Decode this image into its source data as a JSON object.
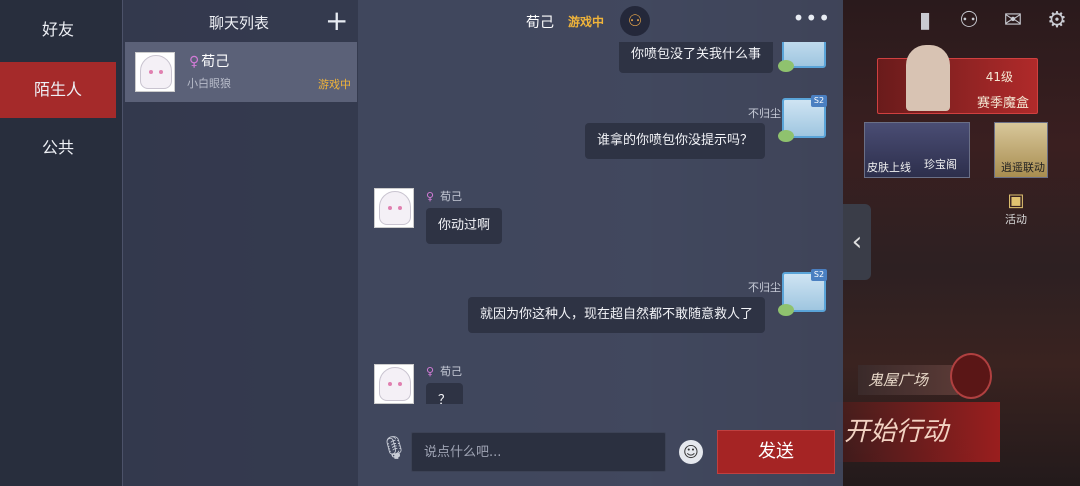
{
  "tabs": [
    {
      "label": "好友",
      "active": false
    },
    {
      "label": "陌生人",
      "active": true
    },
    {
      "label": "公共",
      "active": false
    }
  ],
  "chat_list": {
    "title": "聊天列表",
    "add_icon": "plus-icon",
    "items": [
      {
        "name": "荀己",
        "subtitle": "小白眼狼",
        "status": "游戏中"
      }
    ]
  },
  "conversation": {
    "peer_name": "荀己",
    "peer_status": "游戏中",
    "add_friend_icon": "add-friend-icon",
    "more_icon": "more-icon",
    "messages": [
      {
        "from": "self",
        "sender": "",
        "text": "你喷包没了关我什么事"
      },
      {
        "from": "self",
        "sender": "不归尘",
        "text": "谁拿的你喷包你没提示吗？"
      },
      {
        "from": "peer",
        "sender": "荀己",
        "text": "你动过啊"
      },
      {
        "from": "self",
        "sender": "不归尘",
        "text": "就因为你这种人，现在超自然都不敢随意救人了"
      },
      {
        "from": "peer",
        "sender": "荀己",
        "text": "？"
      }
    ],
    "self_level_badge": "S2"
  },
  "input": {
    "placeholder": "说点什么吧...",
    "value": "",
    "send_label": "发送",
    "mic_icon": "microphone-icon",
    "emoji_icon": "emoji-icon"
  },
  "background_game": {
    "level": "41级",
    "season_box": "赛季魔盒",
    "skin_card": "皮肤上线",
    "treasure": "珍宝阁",
    "event_card": "逍遥联动",
    "activity": "活动",
    "ghost_banner": "鬼屋广场",
    "start_button": "开始行动"
  },
  "colors": {
    "accent_red": "#a52a2a",
    "status_orange": "#f0b43a",
    "pin_magenta": "#d27bd6"
  }
}
